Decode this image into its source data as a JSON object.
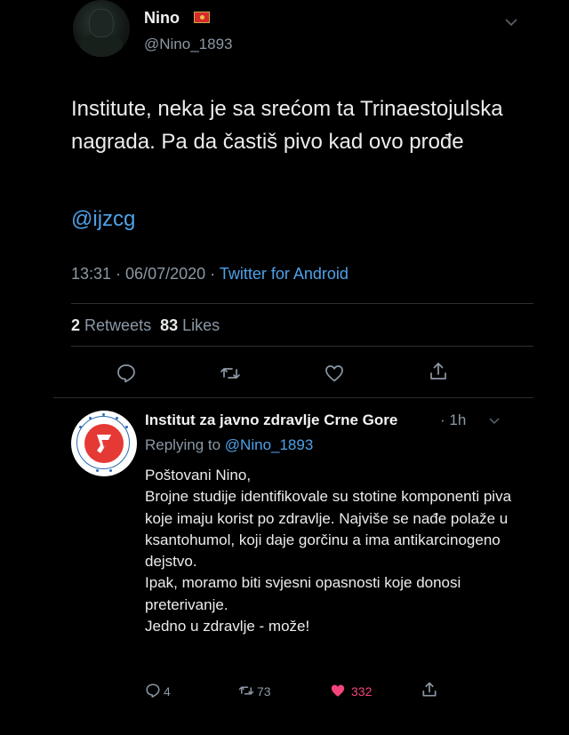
{
  "tweet": {
    "author_name": "Nino",
    "author_handle": "@Nino_1893",
    "text": "Institute, neka je sa srećom ta Trinaestojulska nagrada. Pa da častiš pivo kad ovo prođe",
    "mention": "@ijzcg",
    "timestamp": "13:31 · 06/07/2020 · ",
    "source": "Twitter for Android",
    "retweet_count": "2",
    "retweets_label": "Retweets",
    "like_count": "83",
    "likes_label": "Likes"
  },
  "reply": {
    "author_name": "Institut za javno zdravlje Crne Gore",
    "time": "· 1h",
    "replying_to_label": "Replying to",
    "replying_to_handle": "@Nino_1893",
    "body": "Poštovani Nino,\nBrojne studije identifikovale su stotine komponenti piva koje imaju korist po zdravlje. Najviše se nađe polaže u ksantohumol, koji daje gorčinu a ima antikarcinogeno dejstvo.\nIpak, moramo biti svjesni opasnosti koje donosi preterivanje.\nJedno u zdravlje - može!",
    "reply_count": "4",
    "retweet_count": "73",
    "like_count": "332"
  },
  "colors": {
    "accent": "#4ea1e8",
    "like": "#f4457a",
    "muted": "#8b98a5"
  }
}
